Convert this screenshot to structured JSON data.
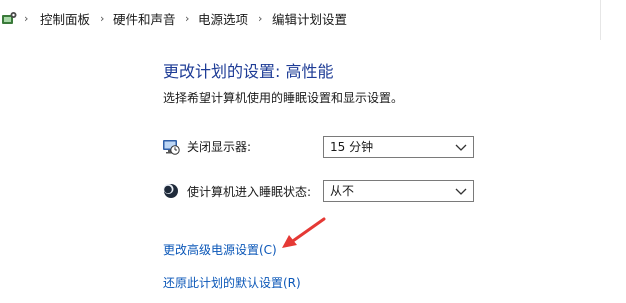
{
  "breadcrumb": {
    "items": [
      "控制面板",
      "硬件和声音",
      "电源选项",
      "编辑计划设置"
    ],
    "separator": "›"
  },
  "main": {
    "title": "更改计划的设置: 高性能",
    "subtitle": "选择希望计算机使用的睡眠设置和显示设置。",
    "display_off": {
      "label": "关闭显示器:",
      "value": "15 分钟",
      "icon": "monitor-clock-icon"
    },
    "sleep": {
      "label": "使计算机进入睡眠状态:",
      "value": "从不",
      "icon": "moon-icon"
    },
    "links": {
      "advanced": "更改高级电源设置(C)",
      "restore": "还原此计划的默认设置(R)"
    }
  },
  "colors": {
    "title": "#1e3c96",
    "link": "#0b57b8",
    "annotation_arrow": "#e53935"
  }
}
